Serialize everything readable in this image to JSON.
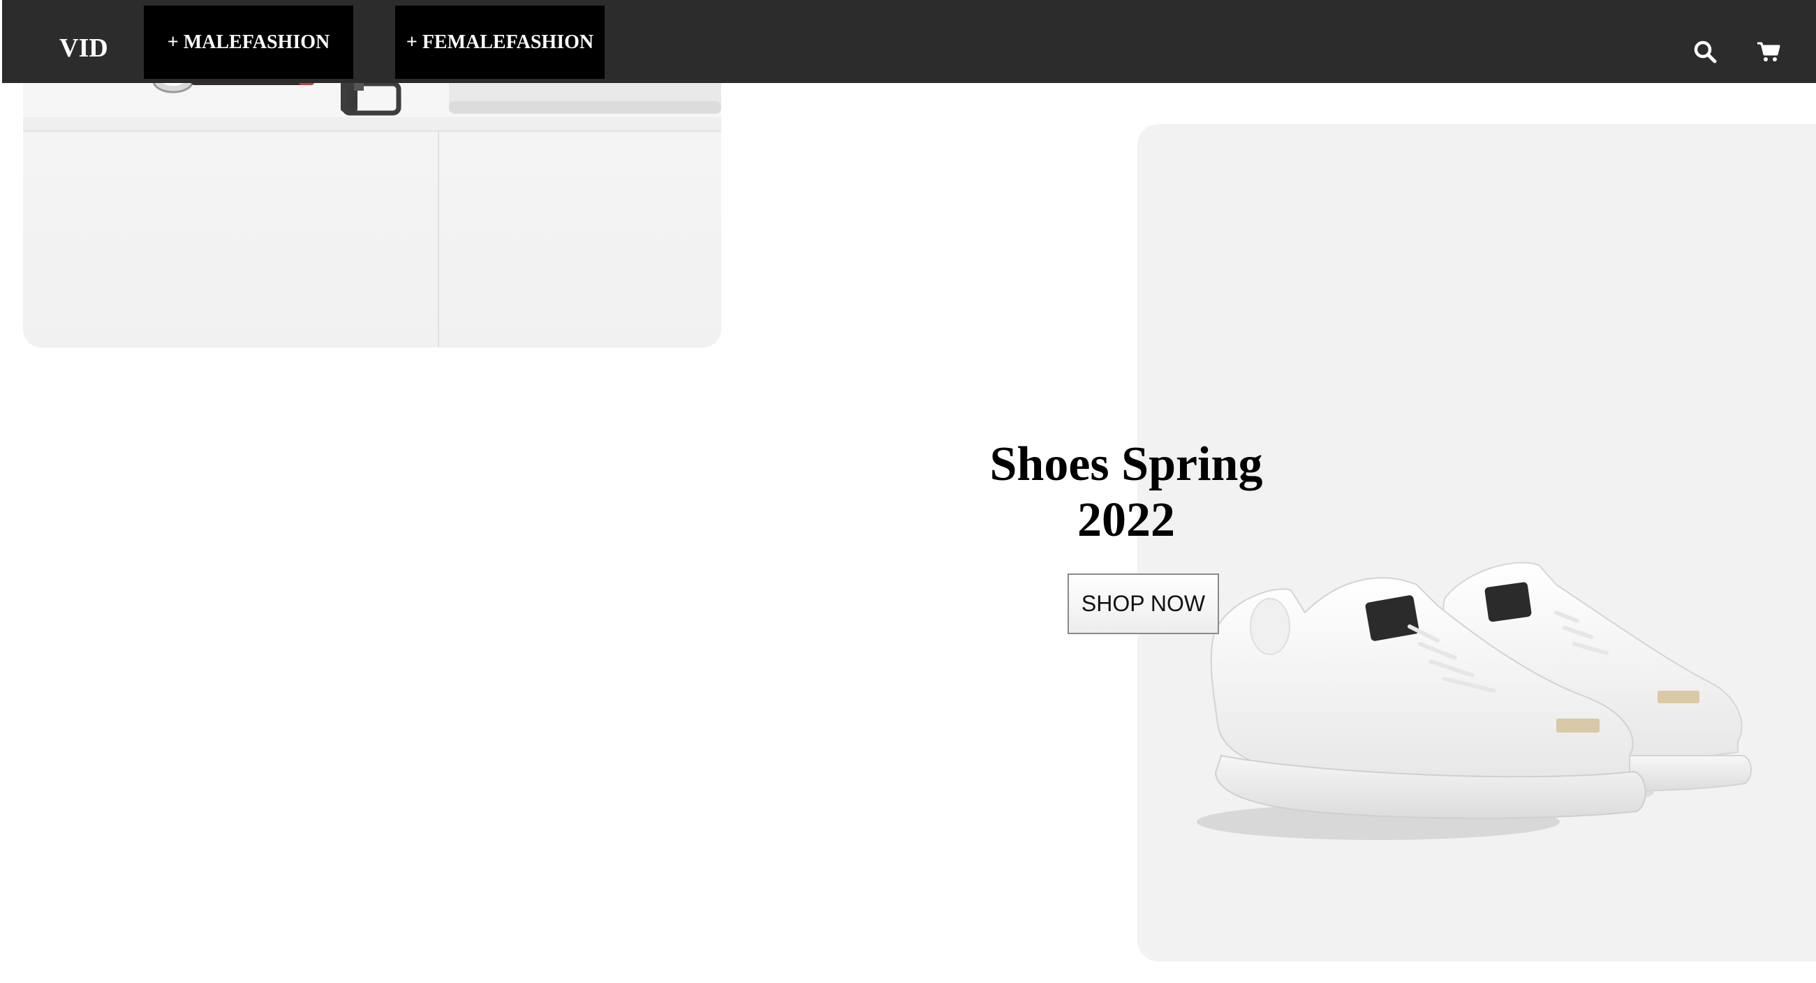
{
  "navbar": {
    "brand": "VID",
    "male_label": "+ MALEFASHION",
    "female_label": "+ FEMALEFASHION",
    "icons": [
      "search-icon",
      "cart-icon"
    ],
    "background": "#2c2c2c",
    "button_background": "#000000"
  },
  "hero": {
    "title": "Shoes Spring 2022",
    "cta_label": "SHOP NOW"
  },
  "images": {
    "left_card": "accessories-flatlay-image",
    "right_card": "white-sneakers-image"
  },
  "colors": {
    "page_background": "#ffffff",
    "card_background": "#f2f2f2",
    "text": "#000000"
  }
}
